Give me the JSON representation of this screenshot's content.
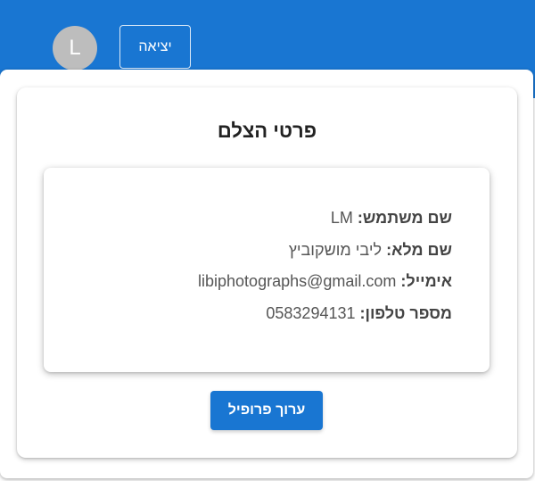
{
  "header": {
    "avatar_letter": "L",
    "logout_label": "יציאה"
  },
  "profile": {
    "title": "פרטי הצלם",
    "fields": [
      {
        "label": "שם משתמש:",
        "value": "LM"
      },
      {
        "label": "שם מלא:",
        "value": "ליבי מושקוביץ"
      },
      {
        "label": "אימייל:",
        "value": "libiphotographs@gmail.com"
      },
      {
        "label": "מספר טלפון:",
        "value": "0583294131"
      }
    ],
    "edit_label": "ערוך פרופיל"
  },
  "colors": {
    "primary": "#1976d2",
    "avatar_bg": "#bdbdbd"
  }
}
